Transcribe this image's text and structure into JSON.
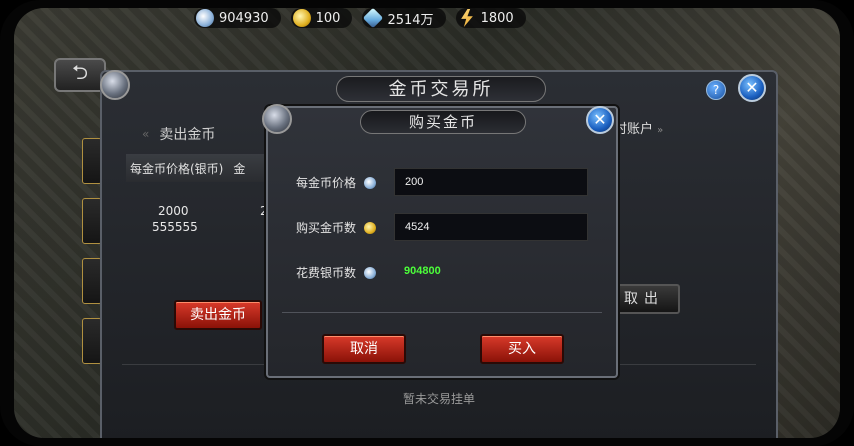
{
  "resources": [
    {
      "icon": "silver-coin-icon",
      "value": "904930"
    },
    {
      "icon": "gold-coin-icon",
      "value": "100"
    },
    {
      "icon": "diamond-icon",
      "value": "2514万"
    },
    {
      "icon": "energy-icon",
      "value": "1800"
    }
  ],
  "exchange": {
    "title": "金币交易所",
    "sell_tab": "卖出金币",
    "account_tab": "时账户",
    "table_headers": [
      "每金币价格(银币)",
      "金"
    ],
    "rows": [
      {
        "price": "2000",
        "partial": "2"
      },
      {
        "price": "555555",
        "partial": ""
      }
    ],
    "sell_button": "卖出金币",
    "withdraw_button": "取出",
    "empty_message": "暂未交易挂单"
  },
  "buy_dialog": {
    "title": "购买金币",
    "price_label": "每金币价格",
    "price_value": "200",
    "quantity_label": "购买金币数",
    "quantity_value": "4524",
    "cost_label": "花费银币数",
    "cost_value": "904800",
    "cancel_button": "取消",
    "buy_button": "买入"
  },
  "colors": {
    "cost_value": "#4cff3a",
    "red_button": "#c0281a",
    "close_button": "#1a5fc0"
  }
}
